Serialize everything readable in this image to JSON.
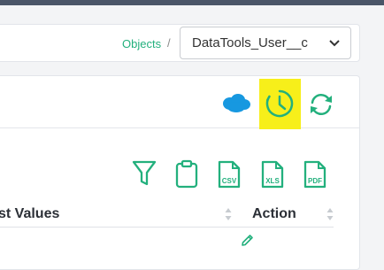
{
  "breadcrumb": {
    "link_label": "Objects",
    "separator": "/",
    "selected_object": "DataTools_User__c"
  },
  "header_actions": {
    "icons": [
      "salesforce-cloud-icon",
      "history-clock-icon",
      "refresh-icon"
    ],
    "highlight_color": "#f7ef1a"
  },
  "toolbar": {
    "icons": [
      "filter-icon",
      "clipboard-icon",
      "csv-file-icon",
      "xls-file-icon",
      "pdf-file-icon"
    ],
    "csv_label": "CSV",
    "xls_label": "XLS",
    "pdf_label": "PDF"
  },
  "table": {
    "columns": [
      "st Values",
      "Action"
    ],
    "rows": [
      {
        "action_icon": "pencil-edit-icon"
      }
    ]
  },
  "colors": {
    "accent": "#23b07d",
    "salesforce_blue": "#1798e0"
  }
}
